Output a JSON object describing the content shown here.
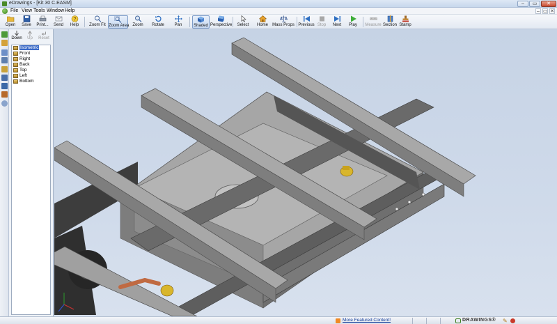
{
  "window": {
    "title": "eDrawings - [Kit 30 C.EASM]",
    "buttons": {
      "minimize": "–",
      "maximize": "▭",
      "close": "✕"
    }
  },
  "menubar": {
    "items": [
      "File",
      "View",
      "Tools",
      "Window",
      "Help"
    ],
    "mdi_buttons": {
      "minimize": "–",
      "restore": "▭",
      "close": "✕"
    }
  },
  "toolbar": {
    "items": [
      {
        "label": "Open",
        "icon": "open-folder-icon",
        "state": "normal"
      },
      {
        "label": "Save",
        "icon": "save-disk-icon",
        "state": "normal"
      },
      {
        "label": "Print...",
        "icon": "printer-icon",
        "state": "normal"
      },
      {
        "label": "Send",
        "icon": "send-envelope-icon",
        "state": "normal"
      },
      {
        "label": "Help",
        "icon": "help-icon",
        "state": "normal"
      },
      {
        "label": "Zoom Fit",
        "icon": "zoom-fit-icon",
        "state": "normal"
      },
      {
        "label": "Zoom Area",
        "icon": "zoom-area-icon",
        "state": "active"
      },
      {
        "label": "Zoom",
        "icon": "zoom-icon",
        "state": "normal"
      },
      {
        "label": "Rotate",
        "icon": "rotate-icon",
        "state": "normal"
      },
      {
        "label": "Pan",
        "icon": "pan-icon",
        "state": "normal"
      },
      {
        "label": "Shaded",
        "icon": "shaded-cube-icon",
        "state": "active"
      },
      {
        "label": "Perspective",
        "icon": "perspective-icon",
        "state": "normal"
      },
      {
        "label": "Select",
        "icon": "select-arrow-icon",
        "state": "normal"
      },
      {
        "label": "Home",
        "icon": "home-icon",
        "state": "normal"
      },
      {
        "label": "Mass Props",
        "icon": "mass-props-icon",
        "state": "normal"
      },
      {
        "label": "Previous",
        "icon": "previous-icon",
        "state": "normal"
      },
      {
        "label": "Stop",
        "icon": "stop-icon",
        "state": "disabled"
      },
      {
        "label": "Next",
        "icon": "next-icon",
        "state": "normal"
      },
      {
        "label": "Play",
        "icon": "play-icon",
        "state": "normal"
      },
      {
        "label": "Measure",
        "icon": "measure-icon",
        "state": "disabled"
      },
      {
        "label": "Section",
        "icon": "section-icon",
        "state": "normal"
      },
      {
        "label": "Stamp",
        "icon": "stamp-icon",
        "state": "normal"
      }
    ]
  },
  "views_panel": {
    "tools": [
      {
        "label": "Down",
        "icon": "down-arrow-icon",
        "state": "normal"
      },
      {
        "label": "Up",
        "icon": "up-arrow-icon",
        "state": "disabled"
      },
      {
        "label": "Reset",
        "icon": "reset-icon",
        "state": "disabled"
      }
    ],
    "views": [
      "Isometric",
      "Front",
      "Right",
      "Back",
      "Top",
      "Left",
      "Bottom"
    ],
    "selected_view": "Isometric"
  },
  "status": {
    "link": "More Featured Content!",
    "brand": "DRAWINGS®"
  },
  "colors": {
    "viewport_bg": "#c9d6e6",
    "model_gray": "#8f8f8f",
    "fitting_brass": "#d9b62c",
    "pipe_copper": "#c06a42"
  }
}
